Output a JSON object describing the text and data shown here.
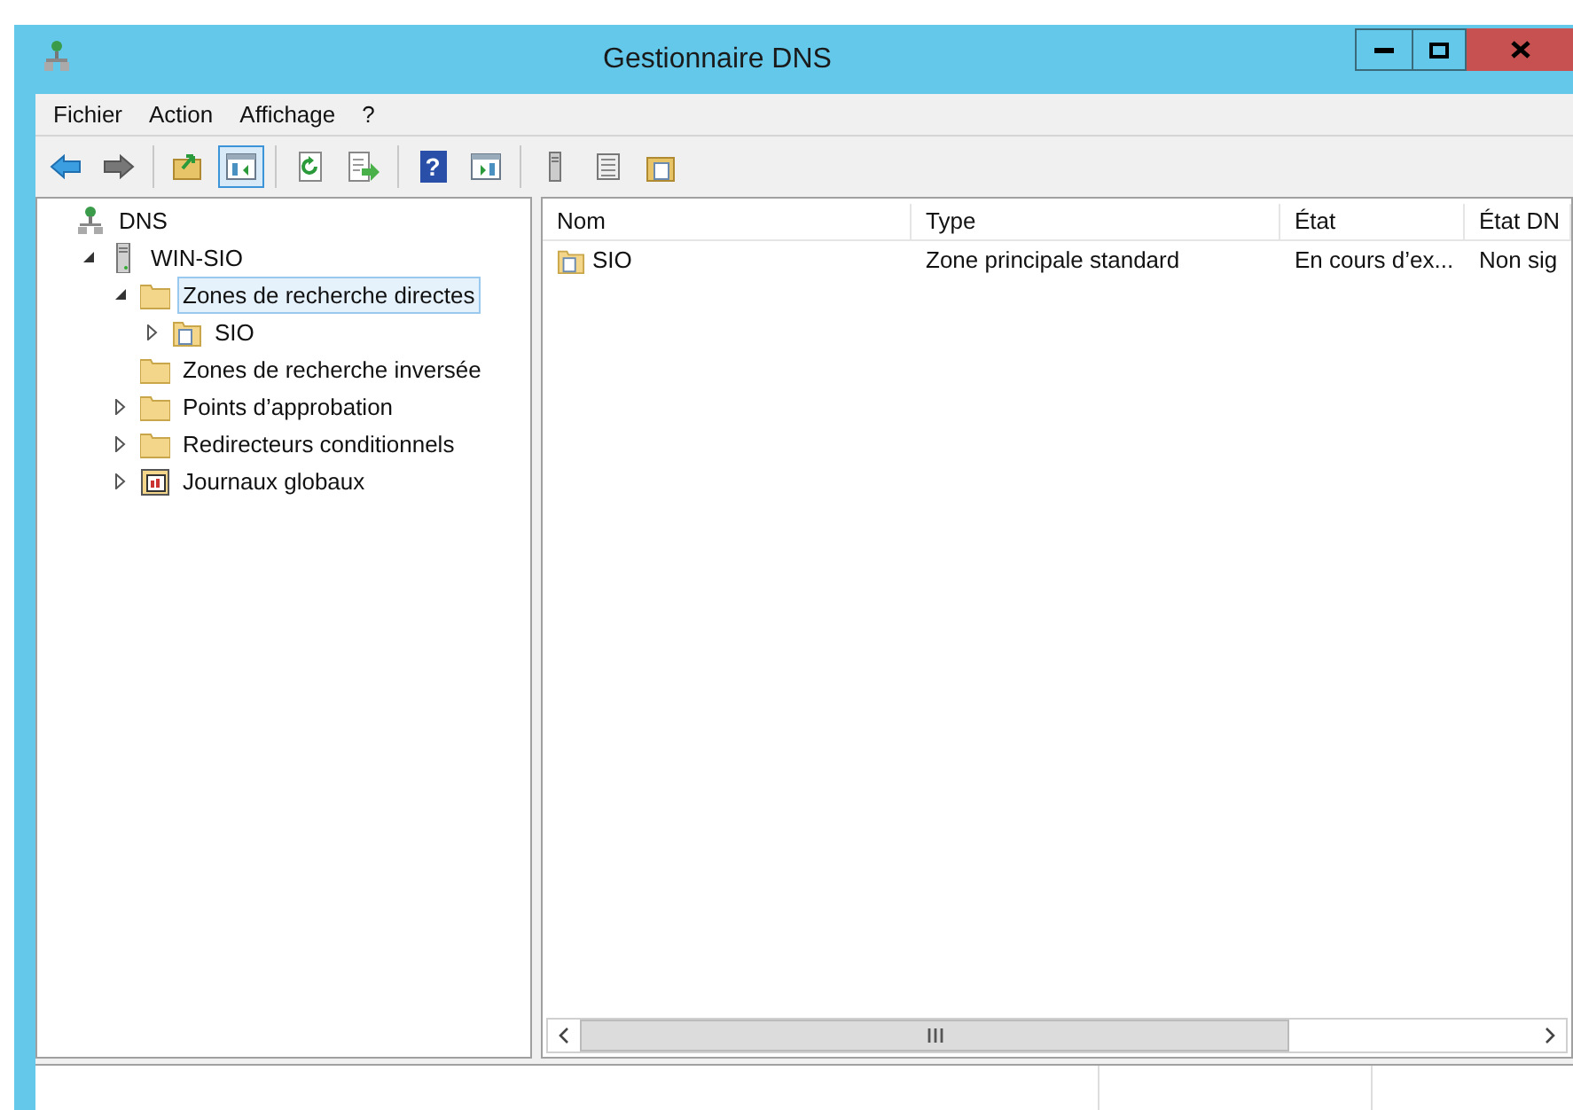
{
  "window": {
    "title": "Gestionnaire DNS"
  },
  "menu": [
    "Fichier",
    "Action",
    "Affichage",
    "?"
  ],
  "toolbar": [
    {
      "kind": "back"
    },
    {
      "kind": "forward"
    },
    {
      "kind": "sep"
    },
    {
      "kind": "up",
      "pressed": false
    },
    {
      "kind": "tree",
      "pressed": true
    },
    {
      "kind": "sep"
    },
    {
      "kind": "refresh",
      "pressed": false
    },
    {
      "kind": "export",
      "pressed": false
    },
    {
      "kind": "sep"
    },
    {
      "kind": "help",
      "pressed": false,
      "glyph": "?"
    },
    {
      "kind": "panel",
      "pressed": false
    },
    {
      "kind": "sep"
    },
    {
      "kind": "server",
      "pressed": false
    },
    {
      "kind": "list",
      "pressed": false
    },
    {
      "kind": "zone",
      "pressed": false
    }
  ],
  "tree": [
    {
      "label": "DNS",
      "kind": "dns",
      "expandable": false,
      "selected": false,
      "children": [
        {
          "label": "WIN-SIO",
          "kind": "server",
          "expandable": true,
          "expanded": true,
          "selected": false,
          "children": [
            {
              "label": "Zones de recherche directes",
              "kind": "folder",
              "expandable": true,
              "expanded": true,
              "selected": true,
              "children": [
                {
                  "label": "SIO",
                  "kind": "zone",
                  "expandable": true,
                  "expanded": false,
                  "selected": false
                }
              ]
            },
            {
              "label": "Zones de recherche inversée",
              "kind": "folder",
              "expandable": false,
              "selected": false
            },
            {
              "label": "Points d’approbation",
              "kind": "folder",
              "expandable": true,
              "expanded": false,
              "selected": false
            },
            {
              "label": "Redirecteurs conditionnels",
              "kind": "folder",
              "expandable": true,
              "expanded": false,
              "selected": false
            },
            {
              "label": "Journaux globaux",
              "kind": "log",
              "expandable": true,
              "expanded": false,
              "selected": false
            }
          ]
        }
      ]
    }
  ],
  "table": {
    "columns": [
      "Nom",
      "Type",
      "État",
      "État DN"
    ],
    "rows": [
      [
        "SIO",
        "Zone principale standard",
        "En cours d’ex...",
        "Non sig"
      ]
    ]
  }
}
